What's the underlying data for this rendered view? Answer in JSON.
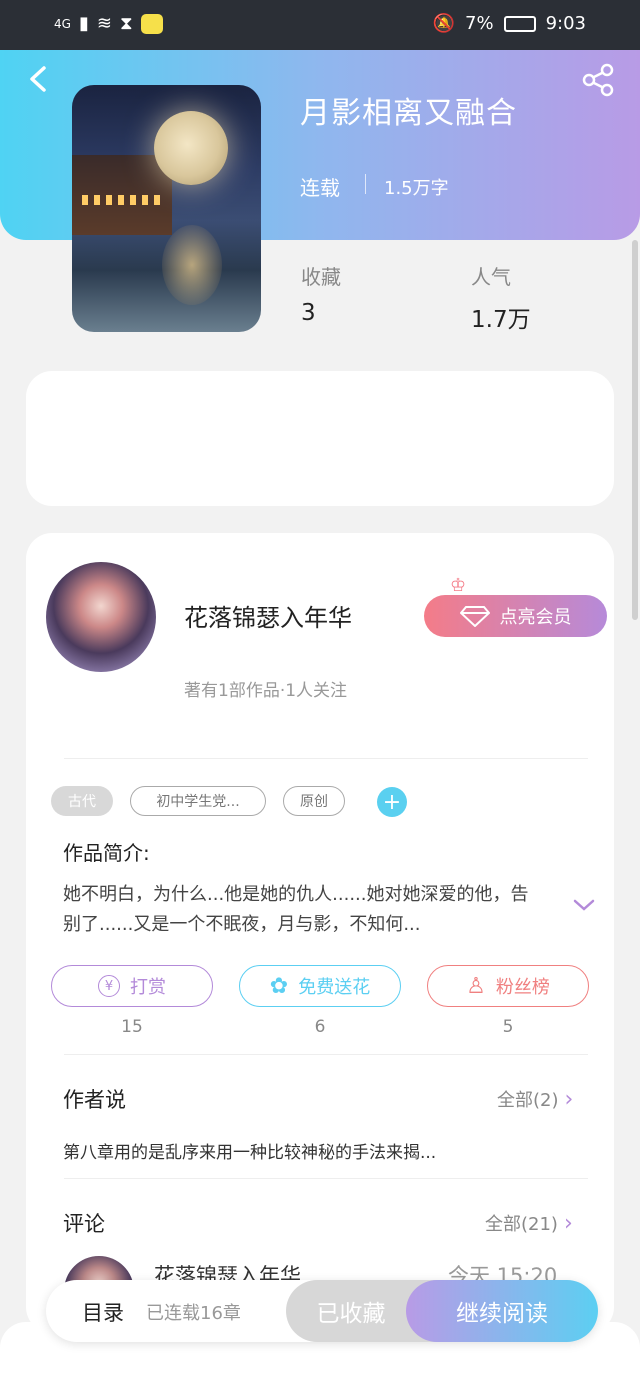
{
  "statusbar": {
    "network": "4G",
    "battery": "7%",
    "time": "9:03"
  },
  "book": {
    "title": "月影相离又融合",
    "status": "连载",
    "word_count": "1.5万字",
    "stats": [
      {
        "label": "收藏",
        "value": "3"
      },
      {
        "label": "人气",
        "value": "1.7万"
      }
    ]
  },
  "author": {
    "name": "花落锦瑟入年华",
    "meta": "著有1部作品·1人关注",
    "vip_button": "点亮会员"
  },
  "tags": [
    "古代",
    "初中学生党...",
    "原创"
  ],
  "intro": {
    "title": "作品简介:",
    "text": "她不明白，为什么...他是她的仇人......她对她深爱的他，告别了......又是一个不眠夜，月与影，不知何..."
  },
  "actions": [
    {
      "label": "打赏",
      "count": "15",
      "color": "#b38ad9",
      "icon": "coin-icon"
    },
    {
      "label": "免费送花",
      "count": "6",
      "color": "#5ccff2",
      "icon": "flower-icon"
    },
    {
      "label": "粉丝榜",
      "count": "5",
      "color": "#f08080",
      "icon": "fan-icon"
    }
  ],
  "author_says": {
    "title": "作者说",
    "more": "全部(2)",
    "snippet": "第八章用的是乱序来用一种比较神秘的手法来揭..."
  },
  "comments": {
    "title": "评论",
    "more": "全部(21)",
    "first": {
      "name": "花落锦瑟入年华",
      "time": "今天 15:20"
    }
  },
  "bottom": {
    "toc": "目录",
    "toc_count": "已连载16章",
    "favorite": "已收藏",
    "continue": "继续阅读"
  }
}
